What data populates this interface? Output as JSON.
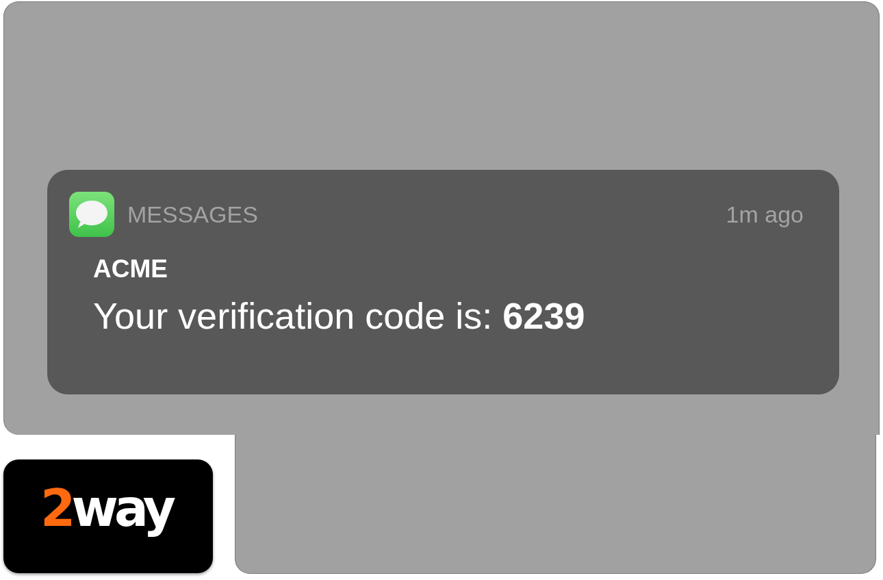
{
  "notification": {
    "app": "MESSAGES",
    "time": "1m ago",
    "sender": "ACME",
    "message": "Your verification code is: **6239**"
  },
  "logo": {
    "accent": "2",
    "rest": "way"
  }
}
